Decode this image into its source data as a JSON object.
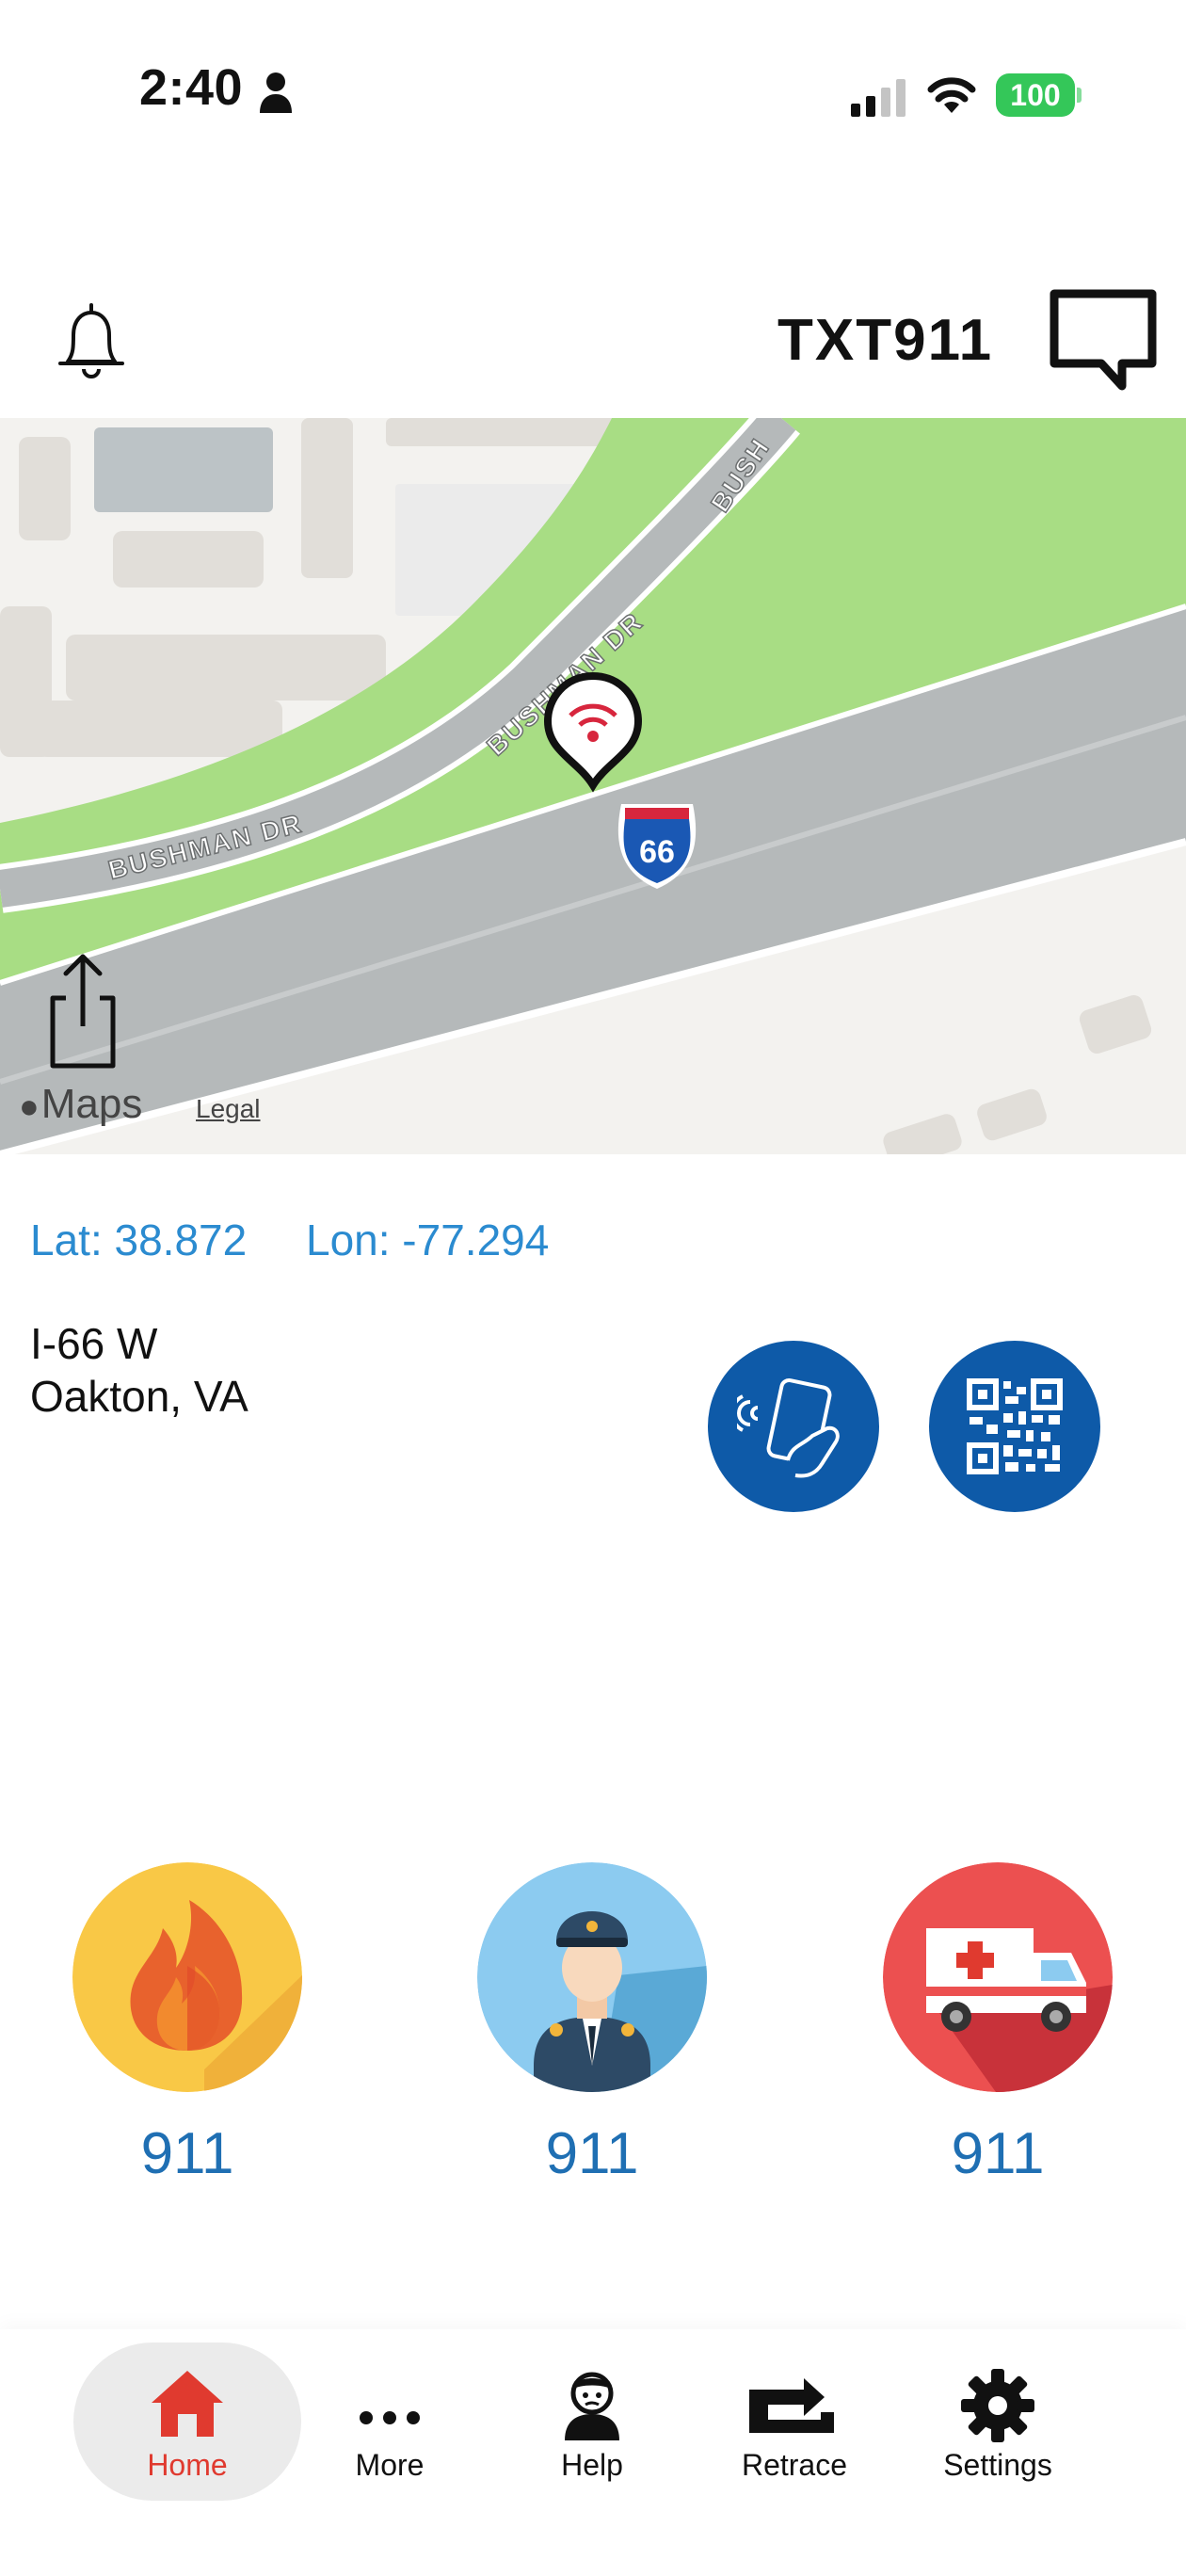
{
  "status_bar": {
    "time": "2:40",
    "battery": "100",
    "colors": {
      "battery": "#34c759"
    }
  },
  "header": {
    "title": "TXT911",
    "icons": [
      "bell-icon",
      "chat-bubble-icon"
    ]
  },
  "map": {
    "road_labels": [
      "BUSHMAN DR",
      "BUSHMAN DR",
      "BUSH"
    ],
    "highway_shield": "66",
    "attribution": "Maps",
    "legal": "Legal",
    "colors": {
      "grass": "#a8dd84",
      "road": "#b5b9ba",
      "building": "#e1ded9"
    }
  },
  "location": {
    "lat": "Lat: 38.872",
    "lon": "Lon: -77.294",
    "address_line1": "I-66 W",
    "address_line2": "Oakton, VA"
  },
  "actions": {
    "nfc_icon": "nfc-phone-icon",
    "qr_icon": "qr-code-icon",
    "color": "#0e5aa8"
  },
  "emergency": [
    {
      "service": "fire",
      "label": "911",
      "icon": "fire-icon",
      "color": "#f9c846"
    },
    {
      "service": "police",
      "label": "911",
      "icon": "police-officer-icon",
      "color": "#8ccbf0"
    },
    {
      "service": "ems",
      "label": "911",
      "icon": "ambulance-icon",
      "color": "#ec5050"
    }
  ],
  "tabs": [
    {
      "label": "Home",
      "icon": "home-icon",
      "active": true
    },
    {
      "label": "More",
      "icon": "more-dots-icon"
    },
    {
      "label": "Help",
      "icon": "help-person-icon"
    },
    {
      "label": "Retrace",
      "icon": "retrace-icon"
    },
    {
      "label": "Settings",
      "icon": "gear-icon"
    }
  ],
  "accent_color": "#e03a2f"
}
